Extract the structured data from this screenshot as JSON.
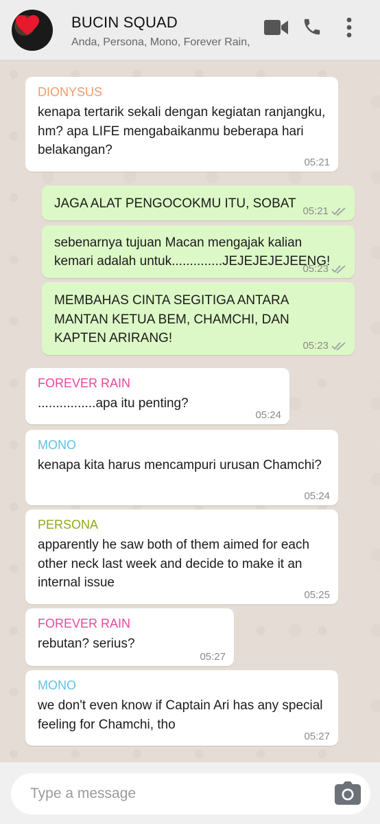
{
  "header": {
    "title": "BUCIN SQUAD",
    "participants": "Anda, Persona, Mono, Forever Rain,",
    "icons": [
      "video-call-icon",
      "voice-call-icon",
      "more-options-icon"
    ]
  },
  "colors": {
    "header_bg": "#ededed",
    "chat_bg": "#e5ddd5",
    "incoming_bubble": "#ffffff",
    "outgoing_bubble": "#dcf8c6",
    "tick_color": "#9aa0a6"
  },
  "messages": [
    {
      "direction": "in",
      "sender": "DIONYSUS",
      "sender_color": "#f39a6b",
      "text": "kenapa tertarik sekali dengan kegiatan ranjangku, hm? apa LIFE mengabaikanmu beberapa hari belakangan?",
      "time": "05:21"
    },
    {
      "direction": "out",
      "text": "JAGA ALAT PENGOCOKMU ITU, SOBAT",
      "time": "05:21",
      "status": "delivered"
    },
    {
      "direction": "out",
      "text": "sebenarnya tujuan Macan mengajak kalian kemari adalah untuk..............JEJEJEJEJEENG!",
      "time": "05:23",
      "status": "delivered"
    },
    {
      "direction": "out",
      "text": "MEMBAHAS CINTA SEGITIGA ANTARA MANTAN KETUA BEM, CHAMCHI, DAN KAPTEN ARIRANG!",
      "time": "05:23",
      "status": "delivered"
    },
    {
      "direction": "in",
      "sender": "FOREVER RAIN",
      "sender_color": "#e8479a",
      "text": "................apa itu penting?",
      "time": "05:24"
    },
    {
      "direction": "in",
      "sender": "MONO",
      "sender_color": "#5ec3e6",
      "text": "kenapa kita harus mencampuri urusan Chamchi?",
      "time": "05:24"
    },
    {
      "direction": "in",
      "sender": "PERSONA",
      "sender_color": "#8fa916",
      "text": "apparently he saw both of them aimed for each other neck last week and decide to make it an internal issue",
      "time": "05:25"
    },
    {
      "direction": "in",
      "sender": "FOREVER RAIN",
      "sender_color": "#e8479a",
      "text": "rebutan? serius?",
      "time": "05:27"
    },
    {
      "direction": "in",
      "sender": "MONO",
      "sender_color": "#5ec3e6",
      "text": "we don't even know if Captain Ari has any special feeling for Chamchi, tho",
      "time": "05:27"
    }
  ],
  "composer": {
    "placeholder": "Type a message",
    "icon": "camera-icon"
  }
}
